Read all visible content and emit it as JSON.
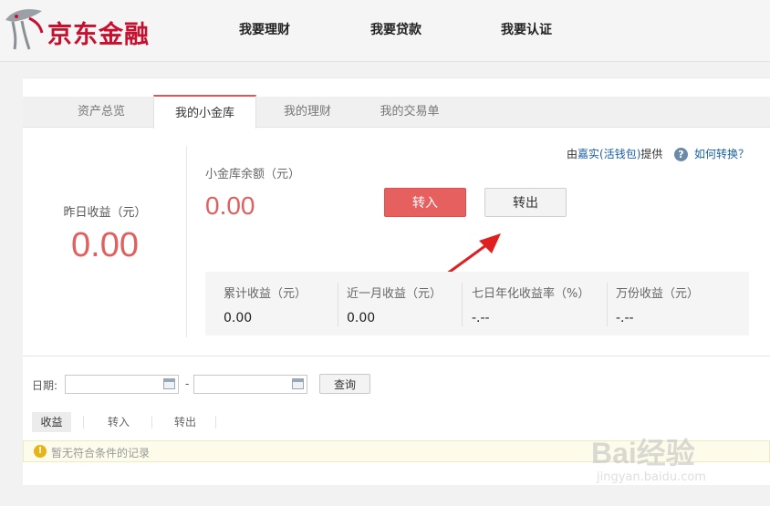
{
  "header": {
    "logo_text": "京东金融",
    "nav": [
      "我要理财",
      "我要贷款",
      "我要认证"
    ]
  },
  "tabs": [
    "资产总览",
    "我的小金库",
    "我的理财",
    "我的交易单"
  ],
  "active_tab": 1,
  "yesterday": {
    "label": "昨日收益（元）",
    "value": "0.00"
  },
  "provider": {
    "prefix": "由",
    "link": "嘉实(活钱包)",
    "suffix": "提供"
  },
  "help_link": "如何转换？",
  "balance": {
    "label": "小金库余额（元）",
    "value": "0.00"
  },
  "buttons": {
    "transfer_in": "转入",
    "transfer_out": "转出"
  },
  "stats": [
    {
      "label": "累计收益（元）",
      "value": "0.00"
    },
    {
      "label": "近一月收益（元）",
      "value": "0.00"
    },
    {
      "label": "七日年化收益率（%）",
      "value": "-.--"
    },
    {
      "label": "万份收益（元）",
      "value": "-.--"
    }
  ],
  "filter": {
    "date_label": "日期:",
    "date_from": "",
    "date_to": "",
    "separator": "-",
    "query_label": "查询"
  },
  "filter_tabs": [
    "收益",
    "转入",
    "转出"
  ],
  "notice": "暂无符合条件的记录",
  "watermark": {
    "brand": "Bai经验",
    "sub": "jingyan.baidu.com"
  },
  "colors": {
    "accent": "#e06060",
    "link": "#1a5fa8",
    "brand": "#c8102e"
  }
}
